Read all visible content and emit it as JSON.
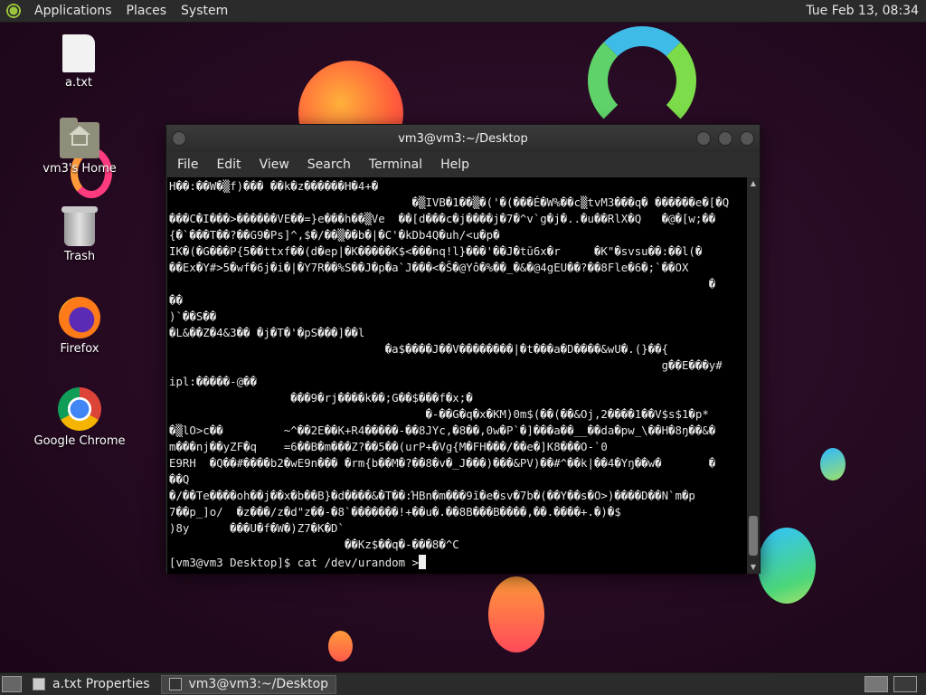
{
  "top_panel": {
    "menus": [
      "Applications",
      "Places",
      "System"
    ],
    "clock": "Tue Feb 13, 08:34"
  },
  "desktop_icons": {
    "file": "a.txt",
    "home": "vm3's Home",
    "trash": "Trash",
    "firefox": "Firefox",
    "chrome": "Google Chrome"
  },
  "terminal": {
    "title": "vm3@vm3:~/Desktop",
    "menus": [
      "File",
      "Edit",
      "View",
      "Search",
      "Terminal",
      "Help"
    ],
    "output": "H��:��W�▒f)��� ��k�z������H�4+�\n                                    �▒IVB�1��▒�('�(���É�W%��c▒tvM3���q� ������e�[�Q\n���C�I���>������VE��=}e���h��▒Ve  ��[d���c�j����j�7�^v`g�j�..�u��RlX�Q   �@�[w;��\n{�`���T��?��G9�Ps]^,$�/��▒��b�|�C'�kDb4Q�uh/<u�p�\nIK�(�G���P{5��ttxf��(d�ep|�K�����K$<���nq!l}���'��J�tū6x�r     �K\"�svsu��:��l(�\n��Ex�Y#>5�wf�6j�i�|�Y7R��%S��J�p�a`J���<�Ŝ�@Yô�%��_�&�@4gEU��?��8Fle�6�;`��OX\n                                                                                �\n��\n)`��S��\n�L&��Z�4&3�� �j�T�'�pS���]��l\n                                �a$����J��V��������|�t���a�D����&wU�.(}��{\n                                                                         g��E���y#\nipl:�����-@��\n                  ���9�rj����k��;G��$���f�x;�\n                                      �-��G�q�x�KM)0m$(��(��&Oj,2����1��V$s$1�p*\n�▒lO>c��         ~^��2E��K+R4�����-��8JYc,�8��,0w�P`�]���a��__��da�pw_\\��H�8ŋ��&�\nm���nj��yZF�q    =6��B�m���Z?��5��(urP+�Vg{M�FH���/��e�]K8���O-`0\nE9RH  �Q��#����b2�wE9n��� �rm{b��M�?��8�v�_J���)���&PV)��#^��k|��4�Yŋ��w�       �\n��Q\n�/��Te����oh��j��x�b��B}�d����&�T��:ΉBn�m���9ĭ�e�sv�7b�(��Y��s�O>)����D��N`m�p\n7��p_]o/  �z���/z�d\"z��-�8`�������!+��u�.��8B���B����,��.����+.�)�$\n)8y      ���U�f�W�)Z7�K�D`\n                          ��Kz$��q�-���8�^C",
    "prompt": "[vm3@vm3 Desktop]$ cat /dev/urandom >"
  },
  "taskbar": {
    "tasks": [
      "a.txt Properties",
      "vm3@vm3:~/Desktop"
    ]
  }
}
